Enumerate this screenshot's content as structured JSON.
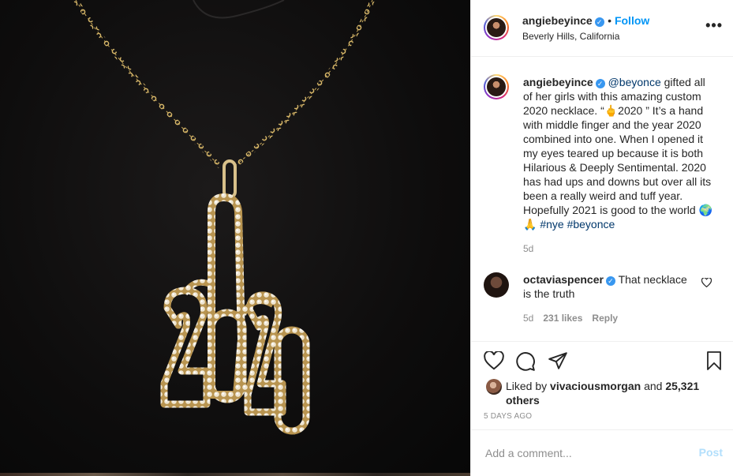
{
  "post": {
    "author": "angiebeyince",
    "follow_label": "Follow",
    "location": "Beverly Hills, California",
    "more_icon": "more-horizontal-icon"
  },
  "caption": {
    "author": "angiebeyince",
    "mention": "@beyonce",
    "text_part1": " gifted all of her girls with this amazing custom 2020 necklace. “",
    "emoji_finger": "🖕",
    "text_part2": "2020 ” It’s a hand with middle finger and the year 2020 combined into one. When I opened it my eyes teared up because it is both Hilarious & Deeply Sentimental. 2020 has had ups and downs but over all its been a really weird and tuff year. Hopefully 2021 is good to the world ",
    "emoji_globe": "🌍",
    "emoji_pray": "🙏",
    "hashtag1": "#nye",
    "hashtag2": "#beyonce",
    "time": "5d"
  },
  "comment": {
    "author": "octaviaspencer",
    "text": " That necklace is the truth",
    "time": "5d",
    "likes": "231 likes",
    "reply": "Reply"
  },
  "likes": {
    "prefix": "Liked by ",
    "user": "vivaciousmorgan",
    "middle": " and ",
    "others": "25,321 others"
  },
  "timestamp": "5 DAYS AGO",
  "add_comment": {
    "placeholder": "Add a comment...",
    "post_label": "Post"
  },
  "colors": {
    "accent": "#0095f6",
    "verified": "#3897f0",
    "muted": "#8e8e8e",
    "post_disabled": "#b2dffc"
  }
}
